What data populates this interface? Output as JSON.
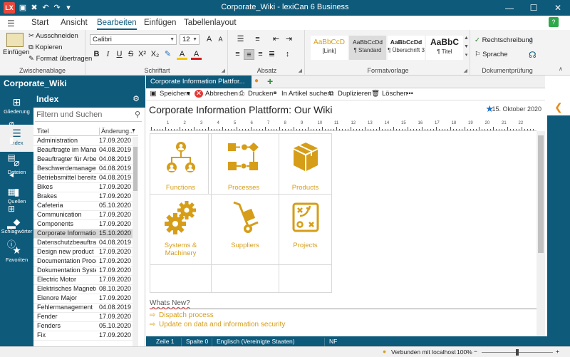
{
  "window": {
    "title": "Corporate_Wiki - lexiCan 6 Business",
    "app_icon_label": "LX",
    "minimize": "—",
    "maximize": "☐",
    "close": "✕"
  },
  "ribbon_tabs": [
    "Start",
    "Ansicht",
    "Bearbeiten",
    "Einfügen",
    "Tabellenlayout"
  ],
  "ribbon": {
    "clipboard": {
      "paste": "Einfügen",
      "cut": "Ausschneiden",
      "copy": "Kopieren",
      "format_painter": "Format übertragen",
      "label": "Zwischenablage"
    },
    "font": {
      "family": "Calibri",
      "size": "12",
      "label": "Schriftart"
    },
    "paragraph": {
      "label": "Absatz"
    },
    "styles": {
      "label": "Formatvorlage",
      "items": [
        {
          "sample": "AaBbCcD",
          "name": "[Link]"
        },
        {
          "sample": "AaBbCcDd",
          "name": "¶ Standard"
        },
        {
          "sample": "AaBbCcDd",
          "name": "¶ Überschrift 3"
        },
        {
          "sample": "AaBbC",
          "name": "¶ Titel"
        }
      ]
    },
    "proofing": {
      "spelling": "Rechtschreibung",
      "language": "Sprache",
      "label": "Dokumentprüfung"
    }
  },
  "sidebar": {
    "wiki_title": "Corporate_Wiki",
    "items": [
      {
        "label": "Gliederung",
        "icon": "outline-icon"
      },
      {
        "label": "Index",
        "icon": "list-icon"
      },
      {
        "label": "Dateien",
        "icon": "paperclip-icon"
      },
      {
        "label": "Quellen",
        "icon": "book-icon"
      },
      {
        "label": "Schlagwörter",
        "icon": "tag-icon"
      },
      {
        "label": "Favoriten",
        "icon": "star-icon"
      }
    ]
  },
  "index": {
    "title": "Index",
    "search_placeholder": "Filtern und Suchen",
    "col_title": "Titel",
    "col_changed": "Änderung...",
    "rows": [
      {
        "title": "Administration",
        "date": "17.09.2020"
      },
      {
        "title": "Beauftragte im Manag...",
        "date": "04.08.2019"
      },
      {
        "title": "Beauftragter für Arbeits...",
        "date": "04.08.2019"
      },
      {
        "title": "Beschwerdemanageme...",
        "date": "04.08.2019"
      },
      {
        "title": "Betriebsmittel bereitste...",
        "date": "04.08.2019"
      },
      {
        "title": "Bikes",
        "date": "17.09.2020"
      },
      {
        "title": "Brakes",
        "date": "17.09.2020"
      },
      {
        "title": "Cafeteria",
        "date": "05.10.2020"
      },
      {
        "title": "Communication",
        "date": "17.09.2020"
      },
      {
        "title": "Components",
        "date": "17.09.2020"
      },
      {
        "title": "Corporate Information...",
        "date": "15.10.2020"
      },
      {
        "title": "Datenschutzbeauftragter",
        "date": "04.08.2019"
      },
      {
        "title": "Design new product",
        "date": "17.09.2020"
      },
      {
        "title": "Documentation Proces...",
        "date": "17.09.2020"
      },
      {
        "title": "Dokumentation System",
        "date": "17.09.2020"
      },
      {
        "title": "Electric Motor",
        "date": "17.09.2020"
      },
      {
        "title": "Elektrisches Magnetve...",
        "date": "08.10.2020"
      },
      {
        "title": "Elenore Major",
        "date": "17.09.2020"
      },
      {
        "title": "Fehlermanagement",
        "date": "04.08.2019"
      },
      {
        "title": "Fender",
        "date": "17.09.2020"
      },
      {
        "title": "Fenders",
        "date": "05.10.2020"
      },
      {
        "title": "Fix",
        "date": "17.09.2020"
      }
    ]
  },
  "document": {
    "tab_label": "Corporate Information Plattfor...",
    "add_tab": "+",
    "toolbar": {
      "save": "Speichern",
      "cancel": "Abbrechen",
      "print": "Drucken",
      "find": "In Artikel suchen",
      "duplicate": "Duplizieren",
      "delete": "Löschen",
      "more": "•••"
    },
    "title": "Corporate Information Plattform: Our Wiki",
    "date": "15. Oktober 2020",
    "ruler_numbers": [
      "1",
      "2",
      "3",
      "4",
      "5",
      "6",
      "7",
      "8",
      "9",
      "10",
      "11",
      "12",
      "13",
      "14",
      "15",
      "16",
      "17",
      "18",
      "19",
      "20",
      "21",
      "22"
    ],
    "tiles": [
      {
        "label": "Functions",
        "icon": "org-chart-icon"
      },
      {
        "label": "Processes",
        "icon": "process-flow-icon"
      },
      {
        "label": "Products",
        "icon": "box-icon"
      },
      {
        "label": "Systems & Machinery",
        "icon": "gears-icon"
      },
      {
        "label": "Suppliers",
        "icon": "hand-truck-icon"
      },
      {
        "label": "Projects",
        "icon": "strategy-board-icon"
      }
    ],
    "whats_new": "Whats New?",
    "news": [
      "Dispatch process",
      "Update on data and information security"
    ]
  },
  "status": {
    "line": "Zeile 1",
    "column": "Spalte 0",
    "language": "Englisch (Vereinigte Staaten)",
    "mode": "NF"
  },
  "bottom": {
    "connection": "Verbunden mit localhost",
    "zoom": "100%",
    "zoom_minus": "−",
    "zoom_plus": "+"
  },
  "colors": {
    "brand": "#0e5a7b",
    "accent": "#d69d18",
    "star": "#1e6fc4",
    "close_red": "#e53935"
  }
}
